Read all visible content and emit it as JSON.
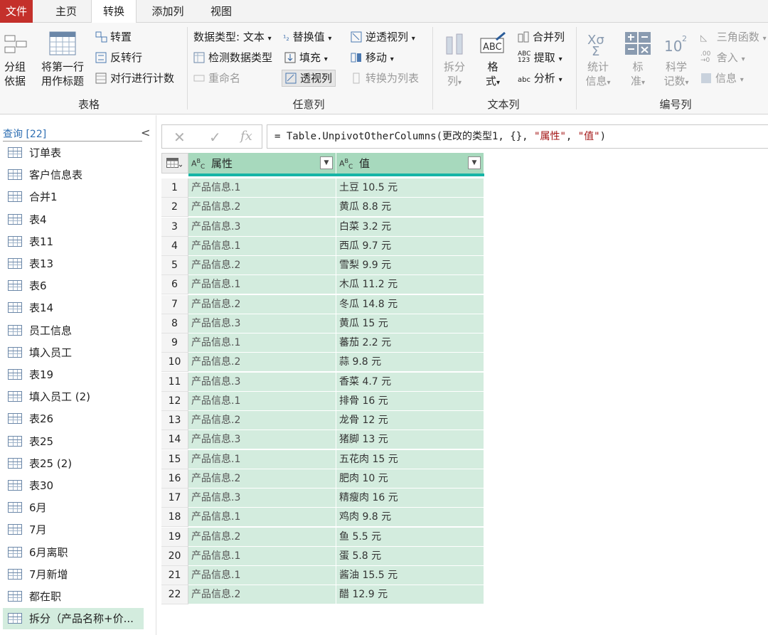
{
  "menu": {
    "file": "文件",
    "tabs": [
      "主页",
      "转换",
      "添加列",
      "视图"
    ]
  },
  "ribbon": {
    "table_group": {
      "label": "表格",
      "group_by": [
        "分组",
        "依据"
      ],
      "first_row": [
        "将第一行",
        "用作标题"
      ],
      "transpose": "转置",
      "reverse": "反转行",
      "count": "对行进行计数"
    },
    "any_col_group": {
      "label": "任意列",
      "data_type": "数据类型: 文本",
      "detect": "检测数据类型",
      "rename": "重命名",
      "replace": "替换值",
      "fill": "填充",
      "pivot": "透视列",
      "unpivot": "逆透视列",
      "move": "移动",
      "to_list": "转换为列表"
    },
    "text_col_group": {
      "label": "文本列",
      "split": [
        "拆分",
        "列"
      ],
      "format": [
        "格",
        "式"
      ],
      "merge": "合并列",
      "extract": "提取",
      "parse": "分析"
    },
    "num_col_group": {
      "label": "编号列",
      "stats": [
        "统计",
        "信息"
      ],
      "standard": [
        "标",
        "准"
      ],
      "scientific": [
        "科学",
        "记数"
      ],
      "trig": "三角函数",
      "round": "舍入",
      "info": "信息"
    }
  },
  "queries": {
    "header": "查询 [22]",
    "items": [
      "订单表",
      "客户信息表",
      "合并1",
      "表4",
      "表11",
      "表13",
      "表6",
      "表14",
      "员工信息",
      "填入员工",
      "表19",
      "填入员工 (2)",
      "表26",
      "表25",
      "表25 (2)",
      "表30",
      "6月",
      "7月",
      "6月离职",
      "7月新增",
      "都在职",
      "拆分（产品名称+价..."
    ],
    "selected_index": 21
  },
  "formula": {
    "prefix": "= Table.UnpivotOtherColumns(更改的类型1, {}, ",
    "arg1": "\"属性\"",
    "sep": ", ",
    "arg2": "\"值\"",
    "suffix": ")"
  },
  "grid": {
    "type_label": "ABC",
    "columns": [
      "属性",
      "值"
    ],
    "rows": [
      [
        "1",
        "产品信息.1",
        "土豆 10.5 元"
      ],
      [
        "2",
        "产品信息.2",
        "黄瓜 8.8 元"
      ],
      [
        "3",
        "产品信息.3",
        "白菜 3.2 元"
      ],
      [
        "4",
        "产品信息.1",
        "西瓜 9.7 元"
      ],
      [
        "5",
        "产品信息.2",
        "雪梨 9.9 元"
      ],
      [
        "6",
        "产品信息.1",
        "木瓜 11.2 元"
      ],
      [
        "7",
        "产品信息.2",
        "冬瓜 14.8 元"
      ],
      [
        "8",
        "产品信息.3",
        "黄瓜 15 元"
      ],
      [
        "9",
        "产品信息.1",
        "蕃茄 2.2 元"
      ],
      [
        "10",
        "产品信息.2",
        "蒜 9.8 元"
      ],
      [
        "11",
        "产品信息.3",
        "香菜 4.7 元"
      ],
      [
        "12",
        "产品信息.1",
        "排骨 16 元"
      ],
      [
        "13",
        "产品信息.2",
        "龙骨 12 元"
      ],
      [
        "14",
        "产品信息.3",
        "猪脚 13 元"
      ],
      [
        "15",
        "产品信息.1",
        "五花肉 15 元"
      ],
      [
        "16",
        "产品信息.2",
        "肥肉 10 元"
      ],
      [
        "17",
        "产品信息.3",
        "精瘦肉 16 元"
      ],
      [
        "18",
        "产品信息.1",
        "鸡肉 9.8 元"
      ],
      [
        "19",
        "产品信息.2",
        "鱼 5.5 元"
      ],
      [
        "20",
        "产品信息.1",
        "蛋 5.8 元"
      ],
      [
        "21",
        "产品信息.1",
        "酱油 15.5 元"
      ],
      [
        "22",
        "产品信息.2",
        "醋 12.9 元"
      ]
    ]
  }
}
